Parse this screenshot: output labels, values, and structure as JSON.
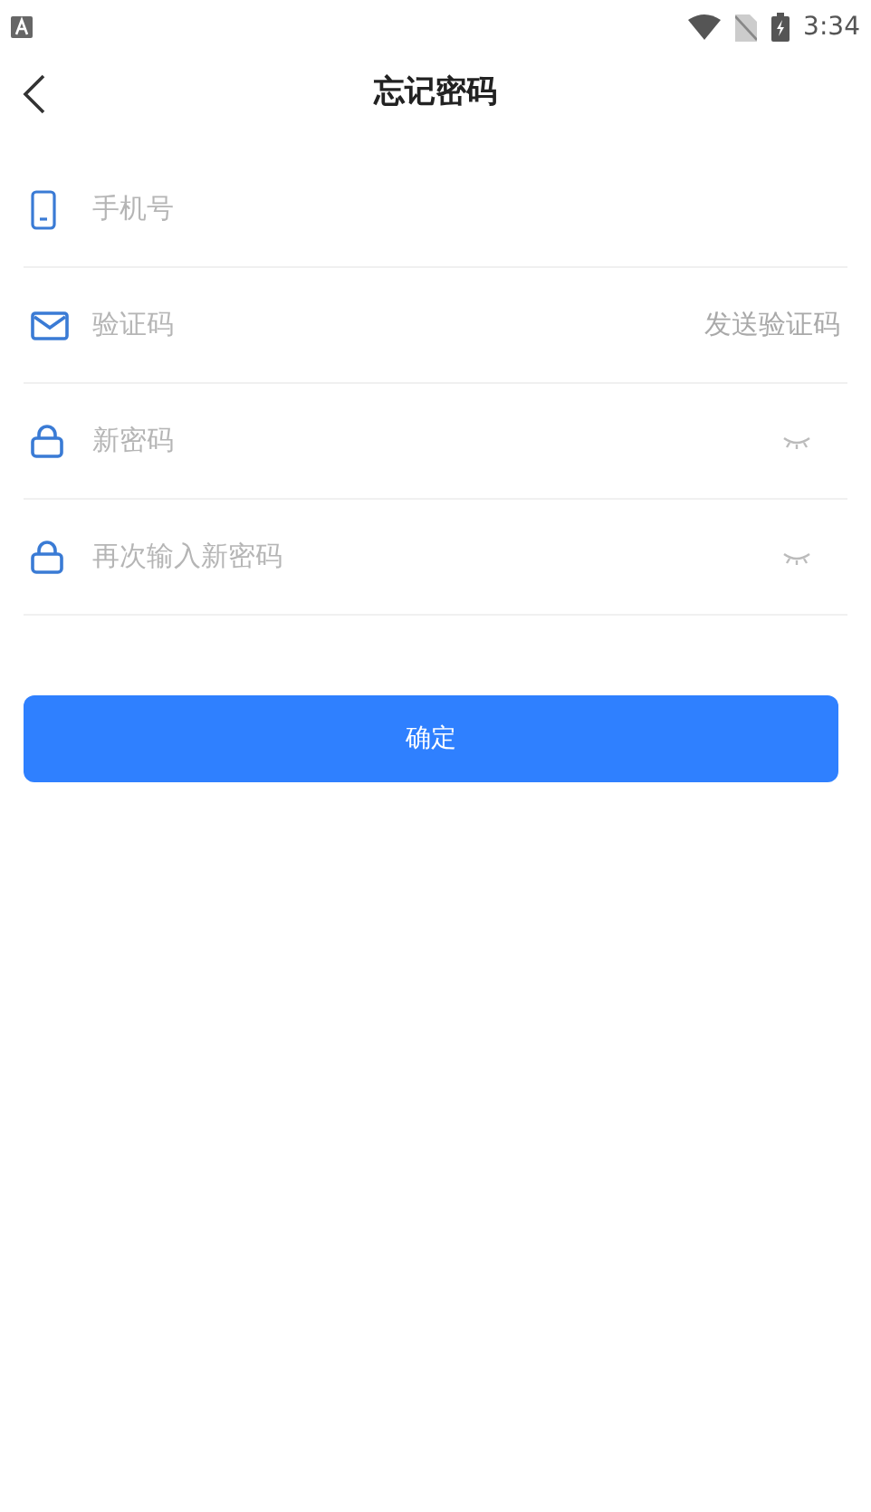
{
  "status_bar": {
    "time": "3:34"
  },
  "header": {
    "title": "忘记密码"
  },
  "fields": [
    {
      "kind": "phone",
      "placeholder": "手机号"
    },
    {
      "kind": "code",
      "placeholder": "验证码",
      "action": "发送验证码"
    },
    {
      "kind": "password",
      "placeholder": "新密码"
    },
    {
      "kind": "password",
      "placeholder": "再次输入新密码"
    }
  ],
  "submit": {
    "label": "确定"
  }
}
